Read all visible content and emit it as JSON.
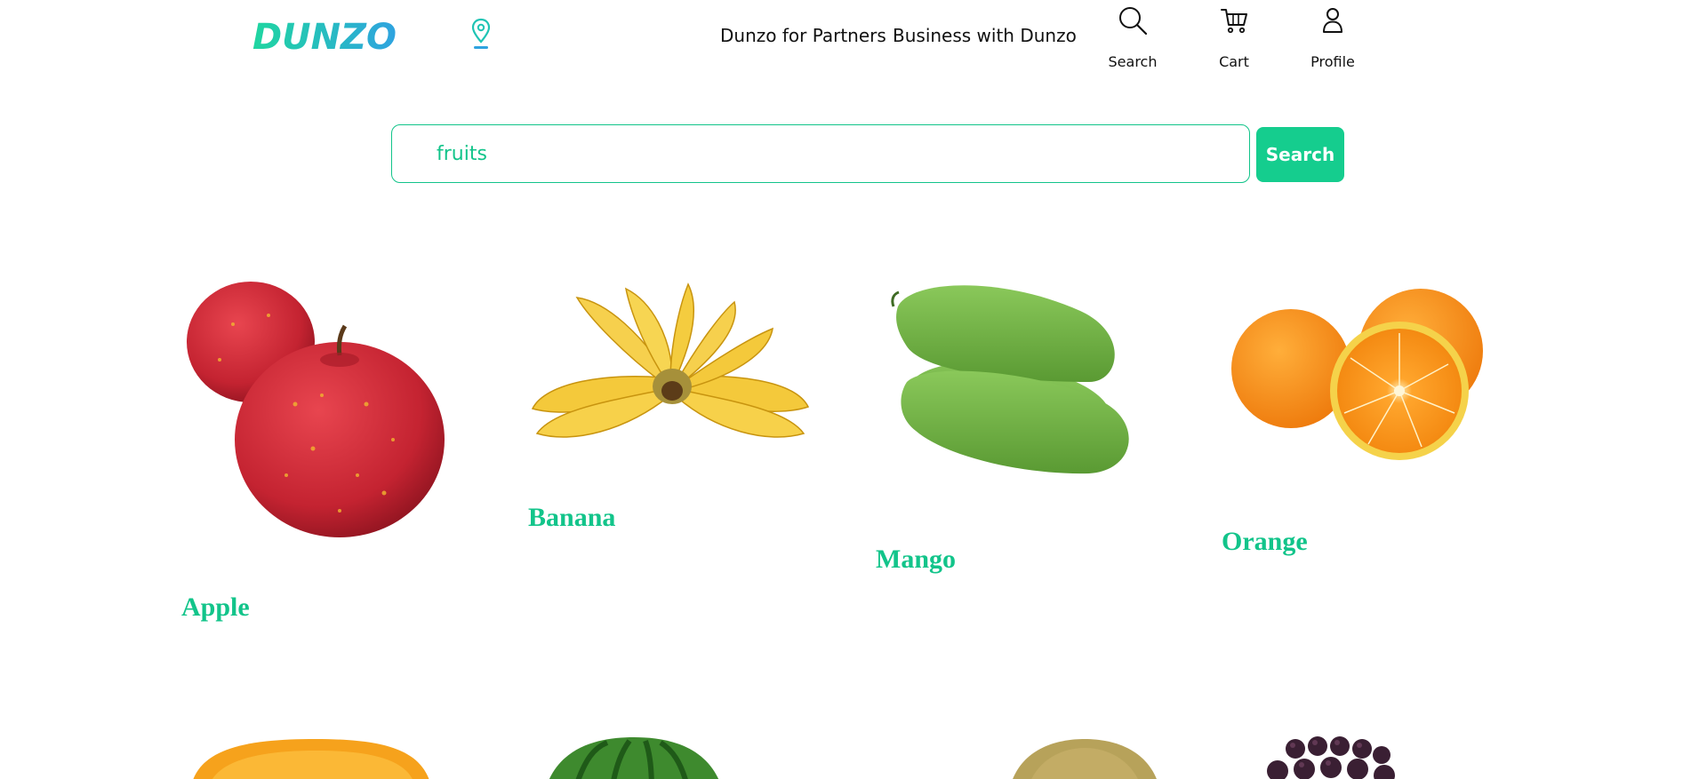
{
  "header": {
    "logo_text": "DUNZO",
    "nav": [
      "Dunzo for Partners",
      "Business with Dunzo"
    ],
    "icons": [
      {
        "label": "Search",
        "icon": "search-icon"
      },
      {
        "label": "Cart",
        "icon": "cart-icon"
      },
      {
        "label": "Profile",
        "icon": "profile-icon"
      }
    ]
  },
  "search": {
    "value": "fruits",
    "button_label": "Search"
  },
  "products": [
    {
      "name": "Apple",
      "image": "apple-image"
    },
    {
      "name": "Banana",
      "image": "banana-image"
    },
    {
      "name": "Mango",
      "image": "mango-image"
    },
    {
      "name": "Orange",
      "image": "orange-image"
    }
  ],
  "products_row2": [
    {
      "image": "papaya-image"
    },
    {
      "image": "watermelon-image"
    },
    {
      "image": "muskmelon-image"
    },
    {
      "image": "grapes-image"
    }
  ],
  "colors": {
    "accent": "#15cd8e",
    "logo_start": "#1fd6a0",
    "logo_end": "#2fa3e0"
  }
}
